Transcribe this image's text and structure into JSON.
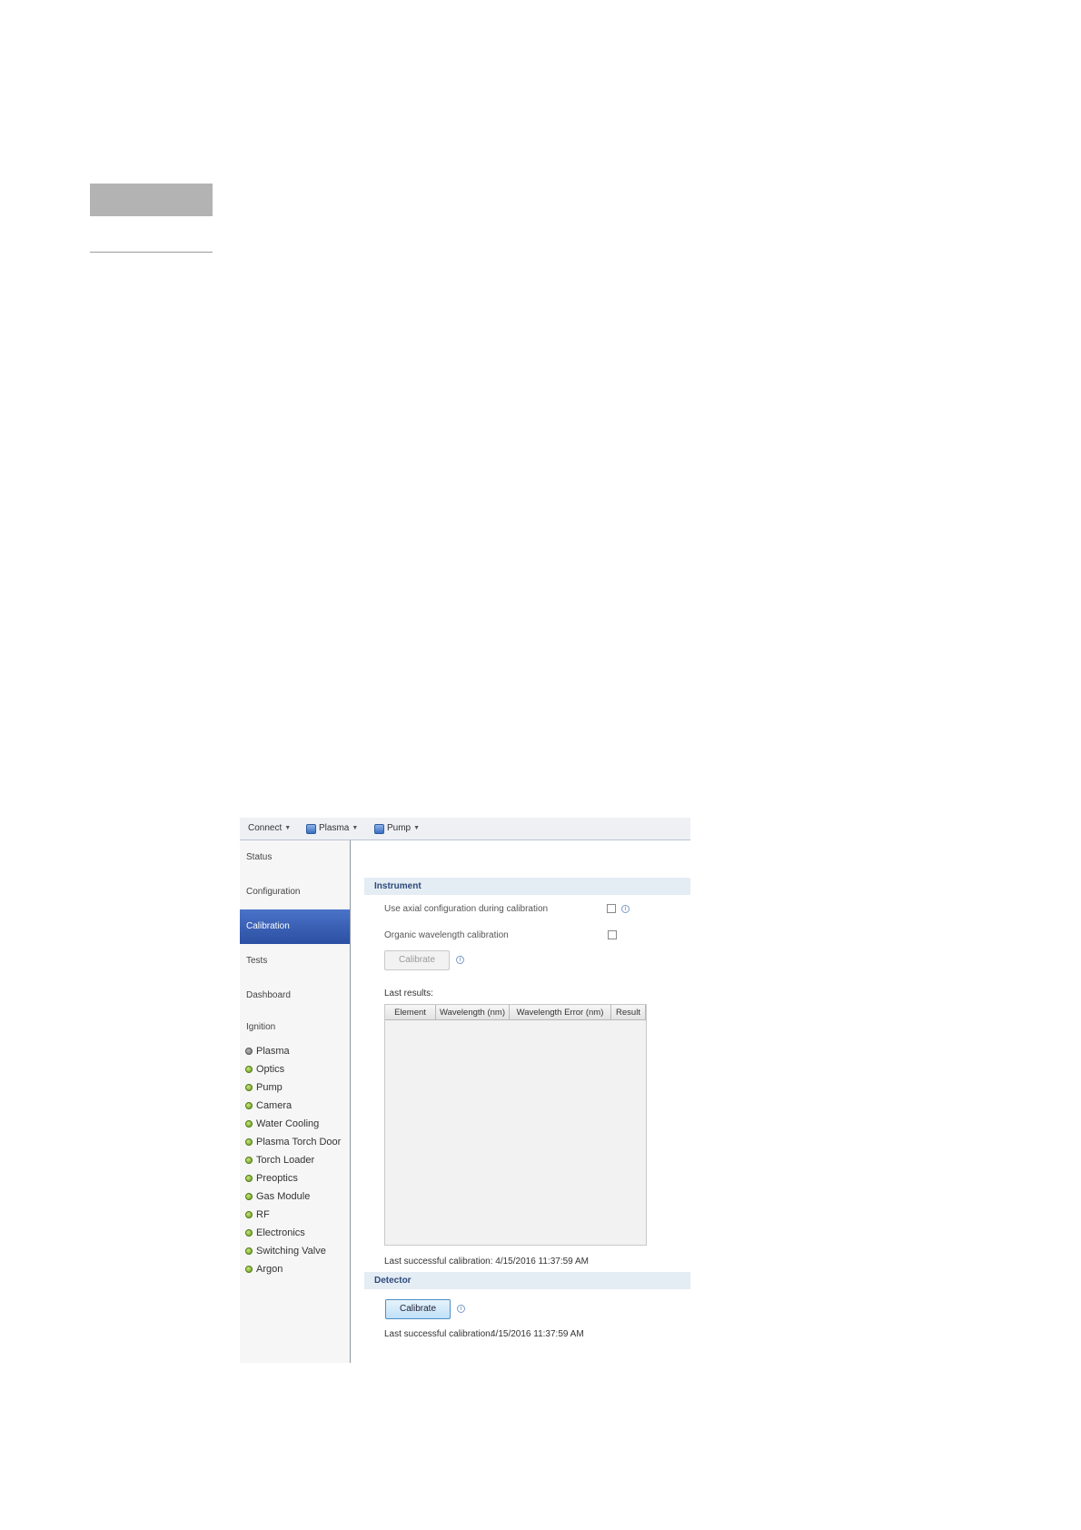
{
  "toolbar": {
    "connect_label": "Connect",
    "plasma_label": "Plasma",
    "pump_label": "Pump"
  },
  "nav": {
    "items": [
      {
        "label": "Status"
      },
      {
        "label": "Configuration"
      },
      {
        "label": "Calibration",
        "active": true
      },
      {
        "label": "Tests"
      },
      {
        "label": "Dashboard"
      }
    ]
  },
  "ignition": {
    "title": "Ignition",
    "items": [
      {
        "label": "Plasma",
        "status": "off"
      },
      {
        "label": "Optics",
        "status": "ok"
      },
      {
        "label": "Pump",
        "status": "ok"
      },
      {
        "label": "Camera",
        "status": "ok"
      },
      {
        "label": "Water Cooling",
        "status": "ok"
      },
      {
        "label": "Plasma Torch Door",
        "status": "ok"
      },
      {
        "label": "Torch Loader",
        "status": "ok"
      },
      {
        "label": "Preoptics",
        "status": "ok"
      },
      {
        "label": "Gas Module",
        "status": "ok"
      },
      {
        "label": "RF",
        "status": "ok"
      },
      {
        "label": "Electronics",
        "status": "ok"
      },
      {
        "label": "Switching Valve",
        "status": "ok"
      },
      {
        "label": "Argon",
        "status": "ok"
      }
    ]
  },
  "instrument": {
    "title": "Instrument",
    "axial_option": "Use axial configuration during calibration",
    "organic_option": "Organic wavelength calibration",
    "calibrate_label": "Calibrate",
    "last_results_label": "Last results:",
    "columns": [
      "Element",
      "Wavelength (nm)",
      "Wavelength Error (nm)",
      "Result"
    ],
    "last_success": "Last successful calibration: 4/15/2016 11:37:59 AM"
  },
  "detector": {
    "title": "Detector",
    "calibrate_label": "Calibrate",
    "last_success_label": "Last successful calibration:",
    "last_success_value": "4/15/2016 11:37:59 AM"
  },
  "colors": {
    "active_nav": "#2b4fa3",
    "status_ok": "#6a9a1e",
    "status_off": "#6e6e6e",
    "section_header_bg": "#e4ecf4"
  }
}
